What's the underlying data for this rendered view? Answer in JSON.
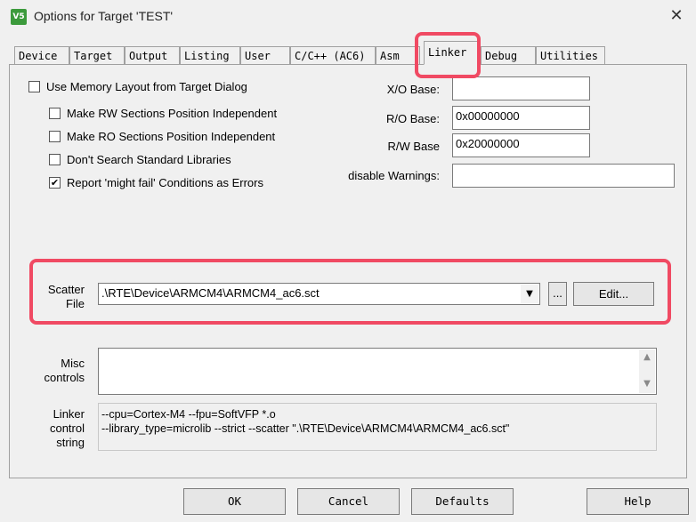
{
  "window": {
    "title": "Options for Target 'TEST'",
    "app_icon_text": "V5"
  },
  "tabs": [
    {
      "label": "Device"
    },
    {
      "label": "Target"
    },
    {
      "label": "Output"
    },
    {
      "label": "Listing"
    },
    {
      "label": "User"
    },
    {
      "label": "C/C++ (AC6)"
    },
    {
      "label": "Asm"
    },
    {
      "label": "Linker",
      "active": true
    },
    {
      "label": "Debug"
    },
    {
      "label": "Utilities"
    }
  ],
  "options": {
    "use_memory_layout": {
      "label": "Use Memory Layout from Target Dialog",
      "checked": false
    },
    "rw_independent": {
      "label": "Make RW Sections Position Independent",
      "checked": false
    },
    "ro_independent": {
      "label": "Make RO Sections Position Independent",
      "checked": false
    },
    "dont_search_libs": {
      "label": "Don't Search Standard Libraries",
      "checked": false
    },
    "report_might_fail": {
      "label": "Report 'might fail' Conditions as Errors",
      "checked": true
    }
  },
  "addresses": {
    "xo_base": {
      "label": "X/O Base:",
      "value": ""
    },
    "ro_base": {
      "label": "R/O Base:",
      "value": "0x00000000"
    },
    "rw_base": {
      "label": "R/W Base",
      "value": "0x20000000"
    },
    "disable_warnings": {
      "label": "disable Warnings:",
      "value": ""
    }
  },
  "scatter": {
    "label_line1": "Scatter",
    "label_line2": "File",
    "value": ".\\RTE\\Device\\ARMCM4\\ARMCM4_ac6.sct",
    "browse_label": "...",
    "edit_label": "Edit..."
  },
  "misc": {
    "label_line1": "Misc",
    "label_line2": "controls",
    "value": ""
  },
  "linker_string": {
    "label_line1": "Linker",
    "label_line2": "control",
    "label_line3": "string",
    "line1": "--cpu=Cortex-M4 --fpu=SoftVFP *.o",
    "line2": "--library_type=microlib --strict --scatter \".\\RTE\\Device\\ARMCM4\\ARMCM4_ac6.sct\""
  },
  "buttons": {
    "ok": "OK",
    "cancel": "Cancel",
    "defaults": "Defaults",
    "help": "Help"
  },
  "colors": {
    "highlight": "#f04a63",
    "app_icon": "#3c9a3c"
  },
  "icons": {
    "close": "close-icon",
    "dropdown": "chevron-down-icon",
    "scroll_up": "scroll-up-icon",
    "scroll_down": "scroll-down-icon"
  }
}
